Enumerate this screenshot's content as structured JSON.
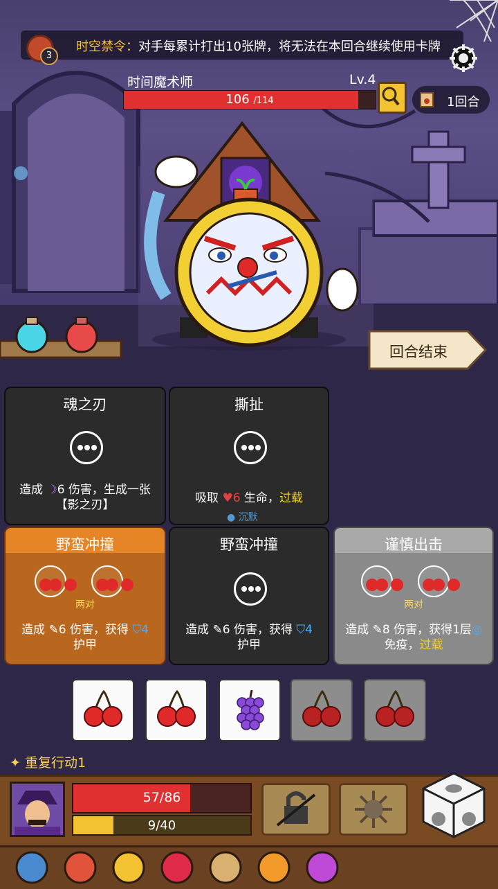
{
  "rule": {
    "count": "3",
    "keyword": "时空禁令：",
    "text": "对手每累计打出10张牌，将无法在本回合继续使用卡牌"
  },
  "enemy": {
    "name": "时间魔术师",
    "level": "Lv.4",
    "hp": "106",
    "hp_max": "/114",
    "hp_fraction": 0.93
  },
  "turn": {
    "label": "1回合"
  },
  "end_turn": {
    "label": "回合结束"
  },
  "cards": [
    {
      "title": "魂之刃",
      "desc_pre": "造成 ",
      "value": "6",
      "desc_mid": " 伤害，生成一张",
      "desc_line2": "【影之刃】"
    },
    {
      "title": "撕扯",
      "desc_pre": "吸取 ",
      "value": "6",
      "desc_mid": " 生命，",
      "keyword": "过载"
    },
    {
      "title": "野蛮冲撞",
      "pairs": "两对",
      "desc_pre": "造成 ",
      "value": "6",
      "desc_mid": " 伤害，获得 ",
      "value2": "4",
      "desc_line2": "护甲"
    },
    {
      "title": "野蛮冲撞",
      "desc_pre": "造成 ",
      "value": "6",
      "desc_mid": " 伤害，获得 ",
      "value2": "4",
      "desc_line2": "护甲"
    },
    {
      "title": "谨慎出击",
      "pairs": "两对",
      "desc_pre": "造成 ",
      "value": "8",
      "desc_mid": " 伤害，获得1层",
      "desc_line2": "免疫，",
      "keyword": "过载"
    }
  ],
  "silence_label": "沉默",
  "dice": [
    {
      "face": "cherry",
      "used": false
    },
    {
      "face": "cherry",
      "used": false
    },
    {
      "face": "grape",
      "used": false
    },
    {
      "face": "cherry",
      "used": true
    },
    {
      "face": "cherry",
      "used": true
    }
  ],
  "repeat_action": "重复行动1",
  "player": {
    "hp": "57/86",
    "hp_fraction": 0.66,
    "shield": "9/40",
    "shield_fraction": 0.225
  },
  "action_buttons": [
    "lock-icon",
    "burst-icon"
  ],
  "relics": [
    "shark-icon",
    "mushroom-icon",
    "card-box-icon",
    "ruby-icon",
    "hourglass-icon",
    "lightning-orb-icon",
    "totem-icon"
  ],
  "colors": {
    "hp": "#e03030",
    "shield": "#f2c233",
    "orange_card": "#e58526",
    "gray_card": "#a9a9a9"
  }
}
